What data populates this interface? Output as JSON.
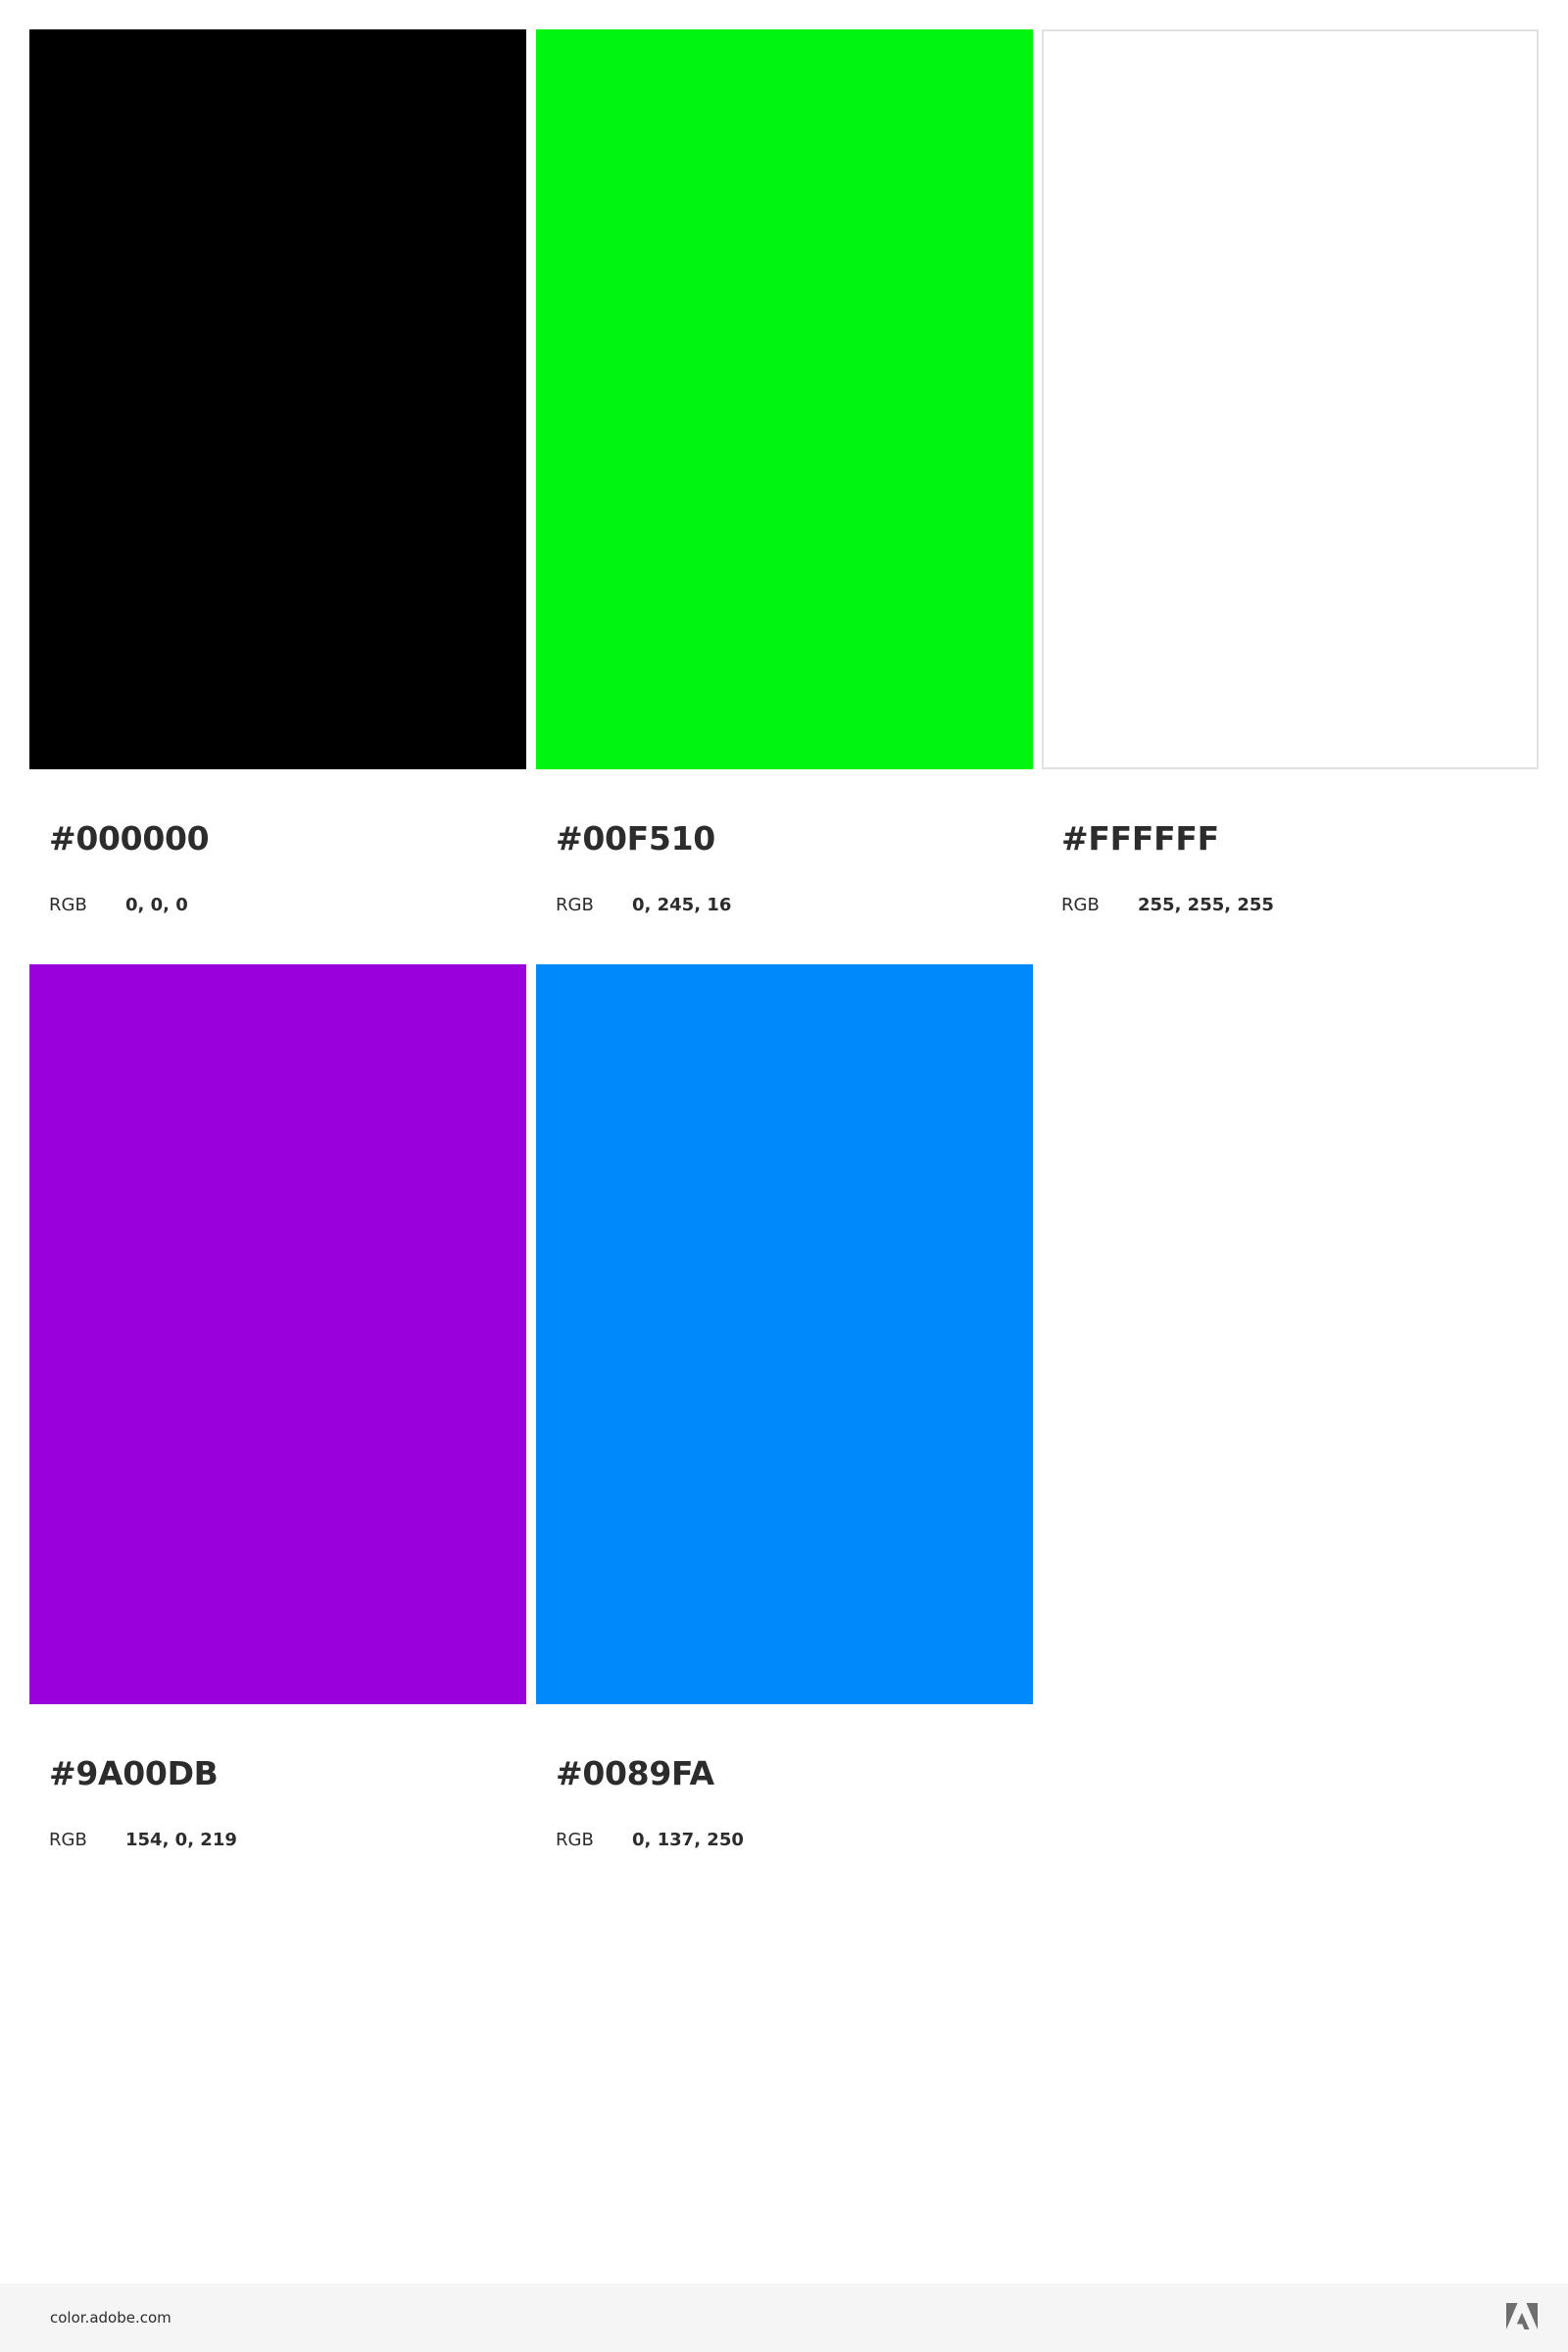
{
  "swatches": [
    {
      "hex": "#000000",
      "rgb_label": "RGB",
      "rgb": "0, 0, 0",
      "color": "#000000"
    },
    {
      "hex": "#00F510",
      "rgb_label": "RGB",
      "rgb": "0, 245, 16",
      "color": "#00F510"
    },
    {
      "hex": "#FFFFFF",
      "rgb_label": "RGB",
      "rgb": "255, 255, 255",
      "color": "#FFFFFF"
    },
    {
      "hex": "#9A00DB",
      "rgb_label": "RGB",
      "rgb": "154, 0, 219",
      "color": "#9A00DB"
    },
    {
      "hex": "#0089FA",
      "rgb_label": "RGB",
      "rgb": "0, 137, 250",
      "color": "#0089FA"
    }
  ],
  "footer": {
    "link_text": "color.adobe.com",
    "logo_icon": "adobe-logo-icon",
    "background": "#F5F5F5"
  }
}
